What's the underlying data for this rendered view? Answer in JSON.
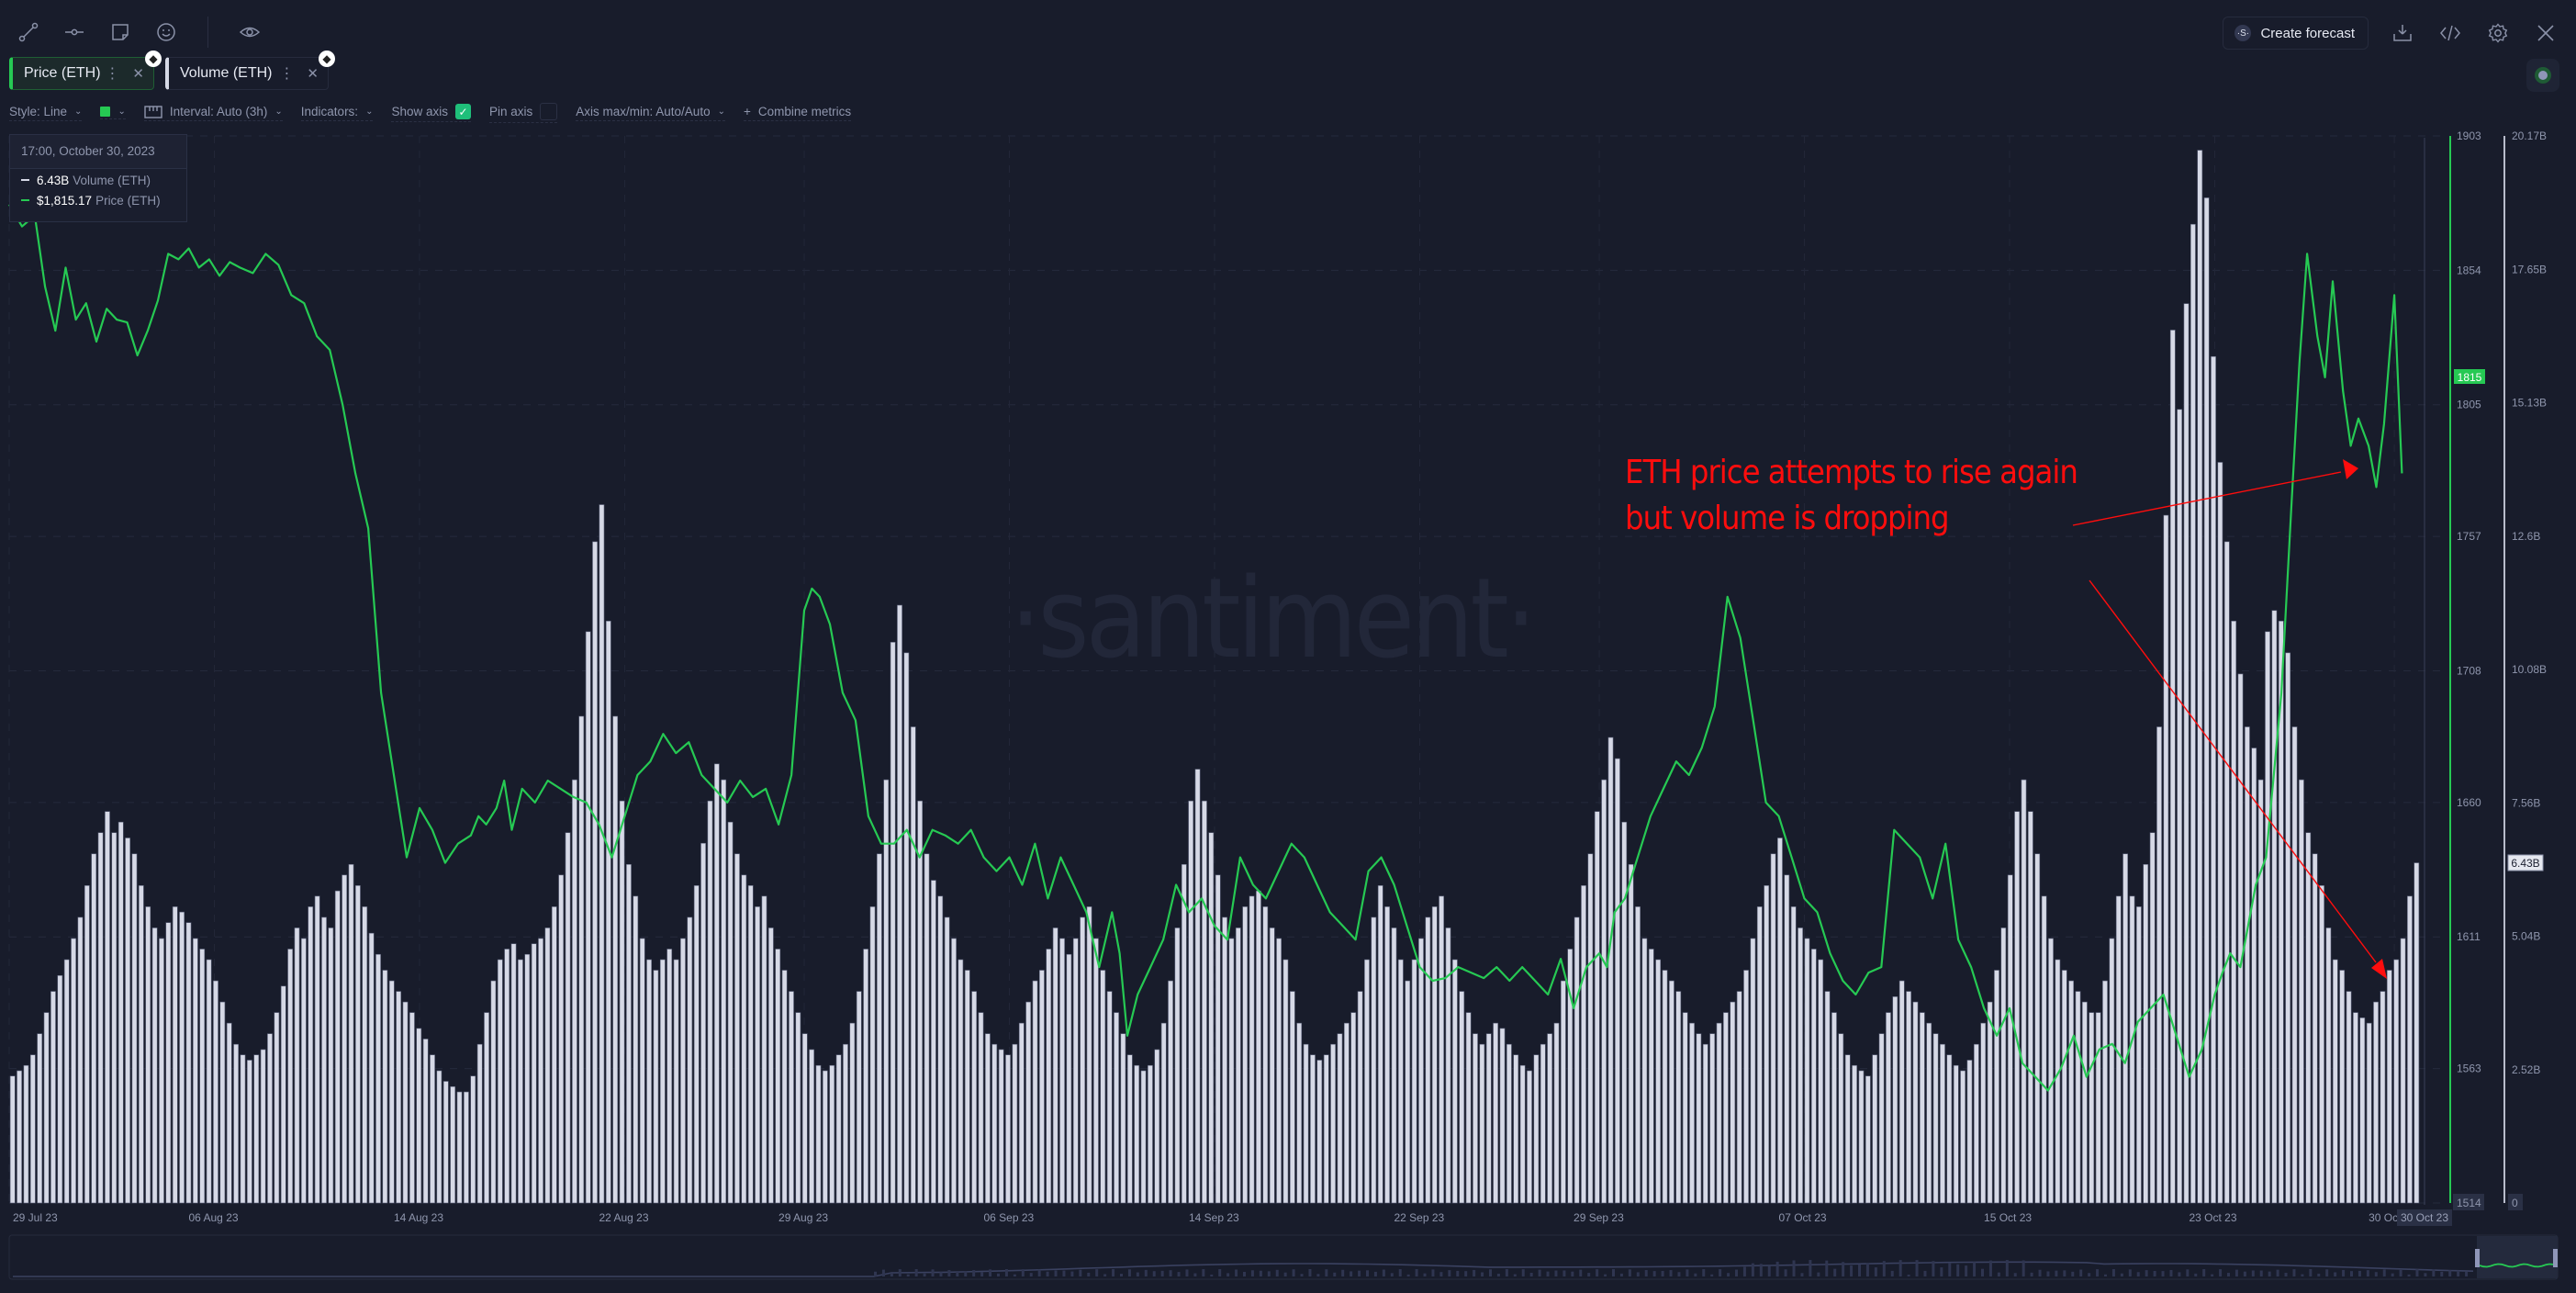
{
  "toolbar": {
    "icons": [
      "line-draw-icon",
      "horizontal-ray-icon",
      "sticky-note-icon",
      "emoji-icon",
      "eye-icon"
    ]
  },
  "metrics": [
    {
      "label": "Price (ETH)",
      "color": "#26c953",
      "asset_icon": "ethereum-icon"
    },
    {
      "label": "Volume (ETH)",
      "color": "#d6d9e6",
      "asset_icon": "ethereum-icon"
    }
  ],
  "settings": {
    "style": "Style: Line",
    "color": "#26c953",
    "interval": "Interval: Auto (3h)",
    "indicators": "Indicators:",
    "show_axis": "Show axis",
    "show_axis_checked": true,
    "pin_axis": "Pin axis",
    "pin_axis_checked": false,
    "axis_maxmin": "Axis max/min: Auto/Auto",
    "combine": "Combine metrics",
    "combine_icon": "+"
  },
  "actions": {
    "create_forecast": "Create forecast",
    "forecast_logo": "·S·"
  },
  "tooltip": {
    "datetime": "17:00, October 30, 2023",
    "rows": [
      {
        "value": "6.43B",
        "name": "Volume (ETH)",
        "color": "#d6d9e6"
      },
      {
        "value": "$1,815.17",
        "name": "Price (ETH)",
        "color": "#26c953"
      }
    ]
  },
  "watermark": "·santiment·",
  "annotation": {
    "line1": "ETH price attempts to rise again",
    "line2": "but volume is dropping",
    "color": "#ff0d0d"
  },
  "chart_data": {
    "type": "line",
    "title": "",
    "xlabel": "",
    "x_tick_labels": [
      "29 Jul 23",
      "06 Aug 23",
      "14 Aug 23",
      "22 Aug 23",
      "29 Aug 23",
      "06 Sep 23",
      "14 Sep 23",
      "22 Sep 23",
      "29 Sep 23",
      "07 Oct 23",
      "15 Oct 23",
      "23 Oct 23",
      "30 Oct 23"
    ],
    "x_tick_days": [
      0,
      8,
      16,
      24,
      31,
      39,
      47,
      55,
      62,
      70,
      78,
      86,
      93
    ],
    "x_range_days": [
      0,
      94
    ],
    "hover_label": "30 Oct 23",
    "grid": true,
    "price_axis": {
      "label": "Price (ETH)",
      "ticks": [
        1903,
        1854,
        1805,
        1757,
        1708,
        1660,
        1611,
        1563,
        1514
      ],
      "range": [
        1514,
        1903
      ],
      "current_value_label": "1815",
      "color": "#26c953"
    },
    "volume_axis": {
      "label": "Volume (ETH)",
      "ticks": [
        "20.17B",
        "17.65B",
        "15.13B",
        "12.6B",
        "10.08B",
        "7.56B",
        "5.04B",
        "2.52B",
        "0"
      ],
      "range": [
        0,
        20.17
      ],
      "unit": "B",
      "current_value_label": "6.43B",
      "color": "#d6d9e6"
    },
    "series": [
      {
        "name": "Price (ETH)",
        "type": "line",
        "color": "#26c953",
        "x_days": [
          0,
          0.5,
          1,
          1.4,
          1.8,
          2.2,
          2.6,
          3,
          3.4,
          3.8,
          4.2,
          4.6,
          5,
          5.4,
          5.8,
          6.2,
          6.6,
          7,
          7.4,
          7.8,
          8.2,
          8.6,
          9,
          9.5,
          10,
          10.5,
          11,
          11.5,
          12,
          12.5,
          13,
          13.5,
          14,
          14.5,
          15,
          15.5,
          16,
          16.5,
          17,
          17.5,
          18,
          18.3,
          18.6,
          19,
          19.3,
          19.6,
          20,
          20.5,
          21,
          21.5,
          22,
          22.5,
          23,
          23.5,
          24,
          24.5,
          25,
          25.5,
          26,
          26.5,
          27,
          27.5,
          28,
          28.5,
          29,
          29.5,
          30,
          30.5,
          31,
          31.3,
          31.6,
          32,
          32.5,
          33,
          33.5,
          34,
          34.5,
          35,
          35.5,
          36,
          36.5,
          37,
          37.5,
          38,
          38.5,
          39,
          39.5,
          40,
          40.5,
          41,
          41.5,
          42,
          42.5,
          43,
          43.3,
          43.6,
          44,
          44.5,
          45,
          45.5,
          46,
          46.5,
          47,
          47.5,
          48,
          48.5,
          49,
          49.5,
          50,
          50.5,
          51,
          51.5,
          52,
          52.5,
          53,
          53.5,
          54,
          54.5,
          55,
          55.5,
          56,
          56.5,
          57,
          57.5,
          58,
          58.5,
          59,
          59.5,
          60,
          60.5,
          61,
          61.5,
          62,
          62.3,
          62.6,
          63,
          63.5,
          64,
          64.5,
          65,
          65.5,
          66,
          66.5,
          67,
          67.5,
          68,
          68.5,
          69,
          69.5,
          70,
          70.5,
          71,
          71.5,
          72,
          72.5,
          73,
          73.5,
          74,
          74.5,
          75,
          75.5,
          76,
          76.5,
          77,
          77.5,
          78,
          78.5,
          79,
          79.5,
          80,
          80.5,
          81,
          81.5,
          82,
          82.5,
          83,
          83.5,
          84,
          84.5,
          85,
          85.5,
          86,
          86.3,
          86.6,
          87,
          87.3,
          87.6,
          88,
          88.3,
          88.6,
          89,
          89.3,
          89.6,
          90,
          90.3,
          90.6,
          91,
          91.3,
          91.6,
          92,
          92.3,
          92.6,
          93,
          93.3
        ],
        "values": [
          1878,
          1870,
          1874,
          1848,
          1832,
          1855,
          1836,
          1842,
          1828,
          1840,
          1836,
          1835,
          1823,
          1832,
          1843,
          1860,
          1858,
          1862,
          1855,
          1858,
          1852,
          1857,
          1855,
          1853,
          1860,
          1856,
          1845,
          1842,
          1830,
          1825,
          1805,
          1780,
          1760,
          1700,
          1670,
          1640,
          1658,
          1650,
          1638,
          1645,
          1648,
          1655,
          1652,
          1658,
          1668,
          1650,
          1665,
          1660,
          1668,
          1665,
          1662,
          1660,
          1652,
          1640,
          1655,
          1670,
          1675,
          1685,
          1678,
          1682,
          1670,
          1665,
          1660,
          1668,
          1662,
          1665,
          1652,
          1670,
          1730,
          1738,
          1735,
          1725,
          1700,
          1690,
          1655,
          1645,
          1645,
          1650,
          1640,
          1650,
          1648,
          1645,
          1650,
          1640,
          1635,
          1640,
          1630,
          1645,
          1625,
          1640,
          1630,
          1620,
          1600,
          1620,
          1605,
          1575,
          1590,
          1600,
          1610,
          1630,
          1620,
          1625,
          1615,
          1610,
          1640,
          1630,
          1625,
          1635,
          1645,
          1640,
          1630,
          1620,
          1615,
          1610,
          1635,
          1640,
          1630,
          1615,
          1600,
          1595,
          1596,
          1600,
          1598,
          1596,
          1600,
          1595,
          1600,
          1595,
          1590,
          1603,
          1585,
          1600,
          1605,
          1600,
          1620,
          1625,
          1640,
          1655,
          1665,
          1675,
          1670,
          1680,
          1695,
          1735,
          1720,
          1690,
          1660,
          1655,
          1640,
          1625,
          1620,
          1605,
          1595,
          1590,
          1598,
          1600,
          1650,
          1645,
          1640,
          1625,
          1645,
          1610,
          1600,
          1585,
          1575,
          1585,
          1565,
          1560,
          1555,
          1563,
          1575,
          1560,
          1570,
          1572,
          1565,
          1580,
          1585,
          1590,
          1575,
          1560,
          1570,
          1590,
          1598,
          1605,
          1600,
          1615,
          1630,
          1640,
          1670,
          1700,
          1770,
          1820,
          1860,
          1830,
          1815,
          1850,
          1810,
          1790,
          1800,
          1790,
          1775,
          1798,
          1845,
          1780,
          1810,
          1790,
          1800,
          1790,
          1782,
          1800,
          1830,
          1790,
          1815
        ]
      },
      {
        "name": "Volume (ETH)",
        "type": "bar",
        "color": "#d6d9e6",
        "unit": "B",
        "x_days_step": 0.375,
        "values": [
          2.4,
          2.5,
          2.6,
          2.8,
          3.2,
          3.6,
          4.0,
          4.3,
          4.6,
          5.0,
          5.4,
          6.0,
          6.6,
          7.0,
          7.4,
          7.0,
          7.2,
          6.9,
          6.6,
          6.0,
          5.6,
          5.2,
          5.0,
          5.3,
          5.6,
          5.5,
          5.3,
          5.0,
          4.8,
          4.6,
          4.2,
          3.8,
          3.4,
          3.0,
          2.8,
          2.7,
          2.8,
          2.9,
          3.2,
          3.6,
          4.1,
          4.8,
          5.2,
          5.0,
          5.6,
          5.8,
          5.4,
          5.2,
          5.9,
          6.2,
          6.4,
          6.0,
          5.6,
          5.1,
          4.7,
          4.4,
          4.2,
          4.0,
          3.8,
          3.6,
          3.3,
          3.1,
          2.8,
          2.5,
          2.3,
          2.2,
          2.1,
          2.1,
          2.4,
          3.0,
          3.6,
          4.2,
          4.6,
          4.8,
          4.9,
          4.6,
          4.7,
          4.9,
          5.0,
          5.2,
          5.6,
          6.2,
          7.0,
          8.0,
          9.2,
          10.8,
          12.5,
          13.2,
          11.0,
          9.2,
          7.6,
          6.4,
          5.8,
          5.0,
          4.6,
          4.4,
          4.6,
          4.8,
          4.6,
          5.0,
          5.4,
          6.0,
          6.8,
          7.6,
          8.3,
          8.0,
          7.2,
          6.6,
          6.2,
          6.0,
          5.6,
          5.8,
          5.2,
          4.8,
          4.4,
          4.0,
          3.6,
          3.2,
          2.9,
          2.6,
          2.5,
          2.6,
          2.8,
          3.0,
          3.4,
          4.0,
          4.8,
          5.6,
          6.6,
          8.0,
          10.6,
          11.3,
          10.4,
          9.0,
          7.6,
          6.6,
          6.1,
          5.8,
          5.4,
          5.0,
          4.6,
          4.4,
          4.0,
          3.6,
          3.2,
          3.0,
          2.9,
          2.8,
          3.0,
          3.4,
          3.8,
          4.2,
          4.4,
          4.8,
          5.2,
          5.0,
          4.7,
          5.0,
          5.4,
          5.6,
          5.0,
          4.4,
          4.0,
          3.6,
          3.2,
          2.8,
          2.6,
          2.5,
          2.6,
          2.9,
          3.4,
          4.2,
          5.2,
          6.4,
          7.6,
          8.2,
          7.6,
          7.0,
          6.2,
          5.4,
          5.0,
          5.2,
          5.6,
          5.8,
          5.9,
          5.6,
          5.2,
          5.0,
          4.6,
          4.0,
          3.4,
          3.0,
          2.8,
          2.7,
          2.8,
          3.0,
          3.2,
          3.4,
          3.6,
          4.0,
          4.6,
          5.4,
          6.0,
          5.6,
          5.2,
          4.6,
          4.2,
          4.6,
          5.0,
          5.4,
          5.6,
          5.8,
          5.2,
          4.6,
          4.0,
          3.6,
          3.2,
          3.0,
          3.2,
          3.4,
          3.3,
          3.0,
          2.8,
          2.6,
          2.5,
          2.8,
          3.0,
          3.2,
          3.4,
          4.2,
          4.8,
          5.4,
          6.0,
          6.6,
          7.4,
          8.0,
          8.8,
          8.4,
          7.2,
          6.4,
          5.6,
          5.0,
          4.8,
          4.6,
          4.4,
          4.2,
          4.0,
          3.6,
          3.4,
          3.2,
          3.0,
          3.2,
          3.4,
          3.6,
          3.8,
          4.0,
          4.4,
          5.0,
          5.6,
          6.0,
          6.6,
          6.9,
          6.2,
          5.6,
          5.2,
          5.0,
          4.8,
          4.6,
          4.0,
          3.6,
          3.2,
          2.8,
          2.6,
          2.5,
          2.4,
          2.8,
          3.2,
          3.6,
          3.9,
          4.2,
          4.0,
          3.8,
          3.6,
          3.4,
          3.2,
          3.0,
          2.8,
          2.6,
          2.5,
          2.7,
          3.0,
          3.4,
          3.8,
          4.4,
          5.2,
          6.2,
          7.4,
          8.0,
          7.4,
          6.6,
          5.8,
          5.0,
          4.6,
          4.4,
          4.2,
          4.0,
          3.8,
          3.6,
          3.6,
          4.2,
          5.0,
          5.8,
          6.6,
          5.8,
          5.6,
          6.4,
          7.0,
          9.0,
          13.0,
          16.5,
          15.0,
          17.0,
          18.5,
          19.9,
          19.0,
          16.0,
          14.0,
          12.5,
          11.0,
          10.0,
          9.0,
          8.6,
          8.0,
          10.8,
          11.2,
          11.0,
          10.4,
          9.0,
          8.0,
          7.0,
          6.6,
          6.0,
          5.2,
          4.6,
          4.4,
          4.0,
          3.6,
          3.5,
          3.4,
          3.8,
          4.0,
          4.4,
          4.6,
          5.0,
          5.8,
          6.43
        ]
      }
    ]
  }
}
